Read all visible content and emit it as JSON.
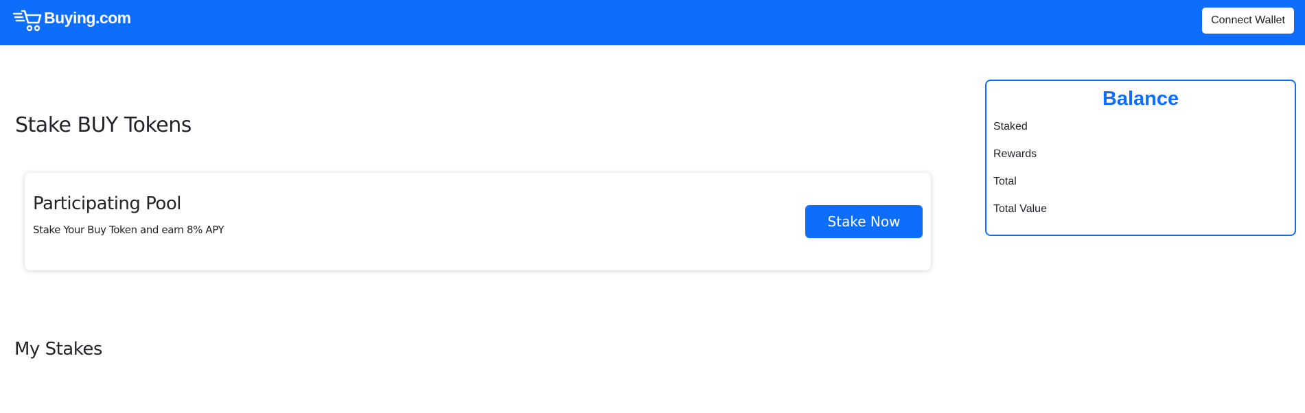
{
  "navbar": {
    "brand": "Buying.com",
    "logo_icon": "shopping-cart-icon",
    "connect_label": "Connect Wallet",
    "bg_color": "#0d6efd"
  },
  "main": {
    "title": "Stake BUY Tokens",
    "pool": {
      "title": "Participating Pool",
      "description": "Stake Your Buy Token and earn 8% APY",
      "button_label": "Stake Now"
    },
    "my_stakes_title": "My Stakes"
  },
  "balance": {
    "title": "Balance",
    "items": [
      "Staked",
      "Rewards",
      "Total",
      "Total Value"
    ],
    "accent_color": "#0d6efd"
  }
}
